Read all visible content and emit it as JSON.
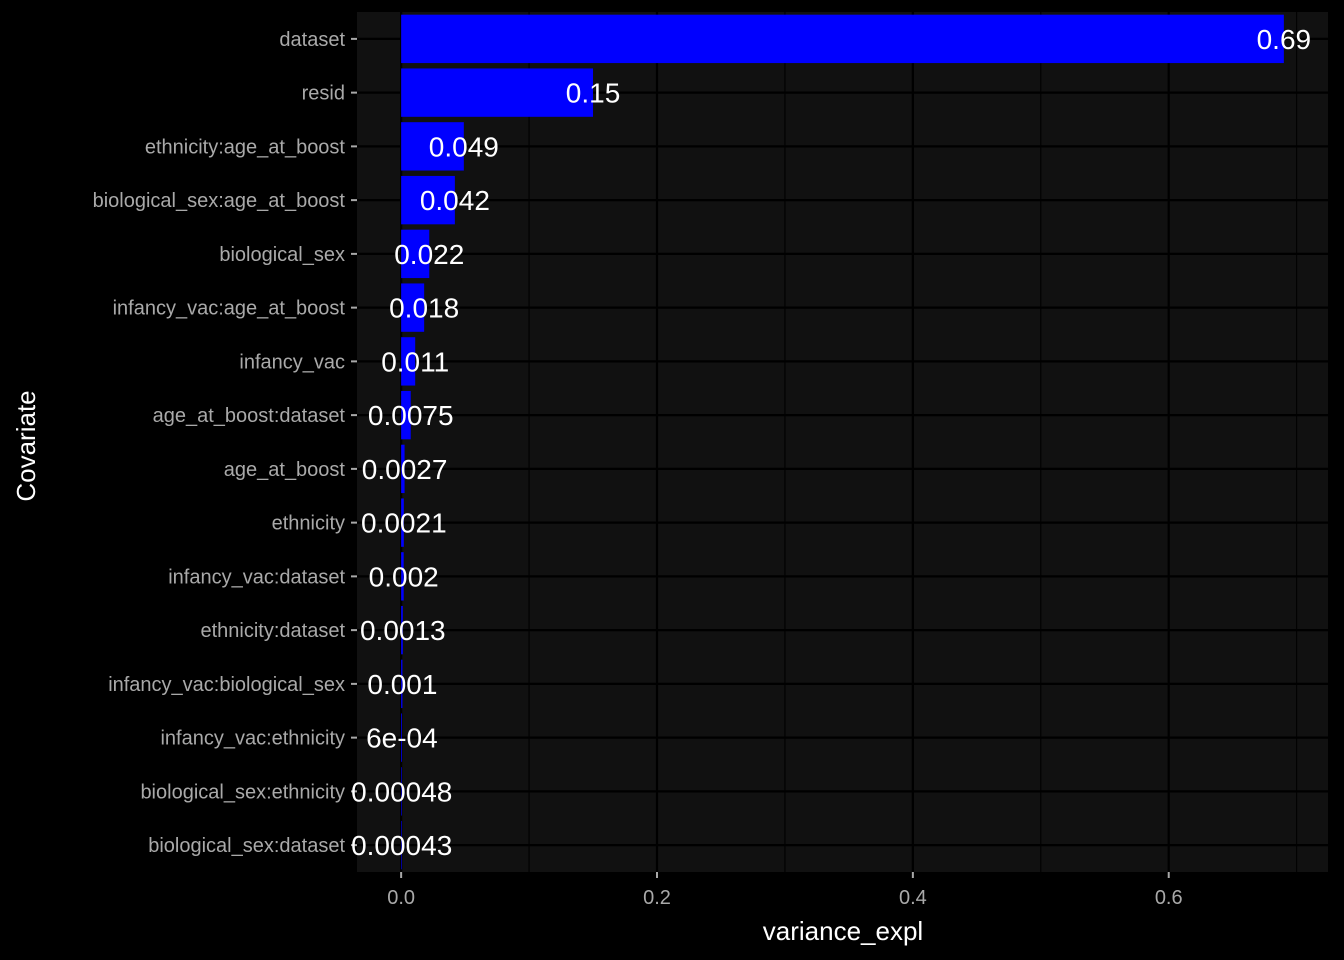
{
  "chart_data": {
    "type": "bar",
    "orientation": "horizontal",
    "xlabel": "variance_expl",
    "ylabel": "Covariate",
    "xlim": [
      -0.0345,
      0.7245
    ],
    "xticks": [
      0.0,
      0.2,
      0.4,
      0.6
    ],
    "xtick_labels": [
      "0.0",
      "0.2",
      "0.4",
      "0.6"
    ],
    "grid": true,
    "legend": "none",
    "categories": [
      "dataset",
      "resid",
      "ethnicity:age_at_boost",
      "biological_sex:age_at_boost",
      "biological_sex",
      "infancy_vac:age_at_boost",
      "infancy_vac",
      "age_at_boost:dataset",
      "age_at_boost",
      "ethnicity",
      "infancy_vac:dataset",
      "ethnicity:dataset",
      "infancy_vac:biological_sex",
      "infancy_vac:ethnicity",
      "biological_sex:ethnicity",
      "biological_sex:dataset"
    ],
    "values": [
      0.69,
      0.15,
      0.049,
      0.042,
      0.022,
      0.018,
      0.011,
      0.0075,
      0.0027,
      0.0021,
      0.002,
      0.0013,
      0.001,
      0.0006,
      0.00048,
      0.00043
    ],
    "value_labels": [
      "0.69",
      "0.15",
      "0.049",
      "0.042",
      "0.022",
      "0.018",
      "0.011",
      "0.0075",
      "0.0027",
      "0.0021",
      "0.002",
      "0.0013",
      "0.001",
      "6e-04",
      "0.00048",
      "0.00043"
    ],
    "colors": {
      "bar": "#0000ff",
      "panel": "#111111",
      "background": "#000000",
      "grid": "#000000",
      "tick_text": "#a9a9a9",
      "title_text": "#ffffff",
      "label_text": "#ffffff"
    }
  }
}
